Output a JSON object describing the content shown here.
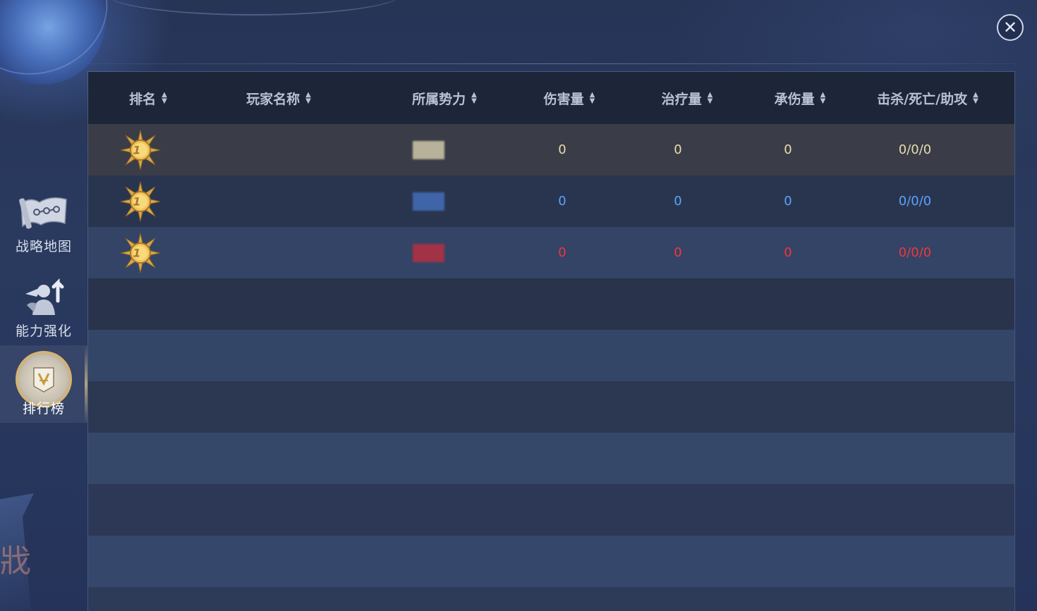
{
  "window": {
    "close_icon": "close-icon",
    "close_glyph": "✕"
  },
  "sidebar": {
    "items": [
      {
        "label": "战略地图",
        "icon": "strategy-map-icon",
        "active": false
      },
      {
        "label": "能力强化",
        "icon": "ability-upgrade-icon",
        "active": false
      },
      {
        "label": "排行榜",
        "icon": "leaderboard-icon",
        "active": true
      }
    ]
  },
  "table": {
    "columns": [
      {
        "label": "排名",
        "sort_icon": "sort-icon"
      },
      {
        "label": "玩家名称",
        "sort_icon": "sort-icon"
      },
      {
        "label": "所属势力",
        "sort_icon": "sort-icon"
      },
      {
        "label": "伤害量",
        "sort_icon": "sort-icon"
      },
      {
        "label": "治疗量",
        "sort_icon": "sort-icon"
      },
      {
        "label": "承伤量",
        "sort_icon": "sort-icon"
      },
      {
        "label": "击杀/死亡/助攻",
        "sort_icon": "sort-icon"
      }
    ],
    "rows": [
      {
        "rank": "1",
        "name": "",
        "faction_color": "#b8b29a",
        "damage": "0",
        "heal": "0",
        "taken": "0",
        "kda": "0/0/0",
        "text_color": "yellow"
      },
      {
        "rank": "1",
        "name": "",
        "faction_color": "#3f65a8",
        "damage": "0",
        "heal": "0",
        "taken": "0",
        "kda": "0/0/0",
        "text_color": "blue"
      },
      {
        "rank": "1",
        "name": "",
        "faction_color": "#a23246",
        "damage": "0",
        "heal": "0",
        "taken": "0",
        "kda": "0/0/0",
        "text_color": "red"
      }
    ]
  },
  "colors": {
    "header_bg": "#1d2538",
    "row_highlight": "#3a3d47",
    "team_yellow": "#e8dcb0",
    "team_blue": "#5aa3ff",
    "team_red": "#f0373d"
  }
}
